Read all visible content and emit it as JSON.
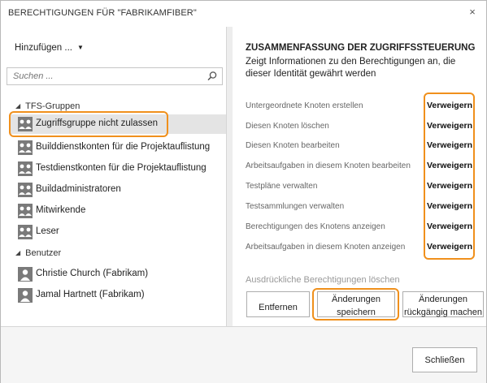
{
  "dialog": {
    "title": "BERECHTIGUNGEN FÜR \"FABRIKAMFIBER\"",
    "close_glyph": "×"
  },
  "left": {
    "add_label": "Hinzufügen ...",
    "add_caret": "▼",
    "search_placeholder": "Suchen ...",
    "tfs_group_label": "TFS-Gruppen",
    "tfs_groups": [
      "Zugriffsgruppe nicht zulassen",
      "Builddienstkonten für die Projektauflistung",
      "Testdienstkonten für die Projektauflistung",
      "Buildadministratoren",
      "Mitwirkende",
      "Leser"
    ],
    "users_label": "Benutzer",
    "users": [
      "Christie Church (Fabrikam)",
      "Jamal Hartnett (Fabrikam)"
    ],
    "selected_index": 0
  },
  "right": {
    "summary_title": "ZUSAMMENFASSUNG DER ZUGRIFFSSTEUERUNG",
    "summary_desc": "Zeigt Informationen zu den Berechtigungen an, die dieser Identität gewährt werden",
    "permissions": [
      {
        "name": "Untergeordnete Knoten erstellen",
        "value": "Verweigern"
      },
      {
        "name": "Diesen Knoten löschen",
        "value": "Verweigern"
      },
      {
        "name": "Diesen Knoten bearbeiten",
        "value": "Verweigern"
      },
      {
        "name": "Arbeitsaufgaben in diesem Knoten bearbeiten",
        "value": "Verweigern"
      },
      {
        "name": "Testpläne verwalten",
        "value": "Verweigern"
      },
      {
        "name": "Testsammlungen verwalten",
        "value": "Verweigern"
      },
      {
        "name": "Berechtigungen des Knotens anzeigen",
        "value": "Verweigern"
      },
      {
        "name": "Arbeitsaufgaben in diesem Knoten anzeigen",
        "value": "Verweigern"
      }
    ],
    "clear_label": "Ausdrückliche Berechtigungen löschen",
    "remove_label": "Entfernen",
    "save_label_1": "Änderungen",
    "save_label_2": "speichern",
    "undo_label_1": "Änderungen",
    "undo_label_2": "rückgängig machen"
  },
  "footer": {
    "close_label": "Schließen"
  },
  "colors": {
    "highlight": "#f0901c",
    "selected_row": "#e4e4e4",
    "icon_gray": "#7a7a7a"
  },
  "icons": {
    "group": "group-icon",
    "user": "user-icon",
    "search": "search-icon",
    "expand": "expanded-triangle-icon"
  }
}
